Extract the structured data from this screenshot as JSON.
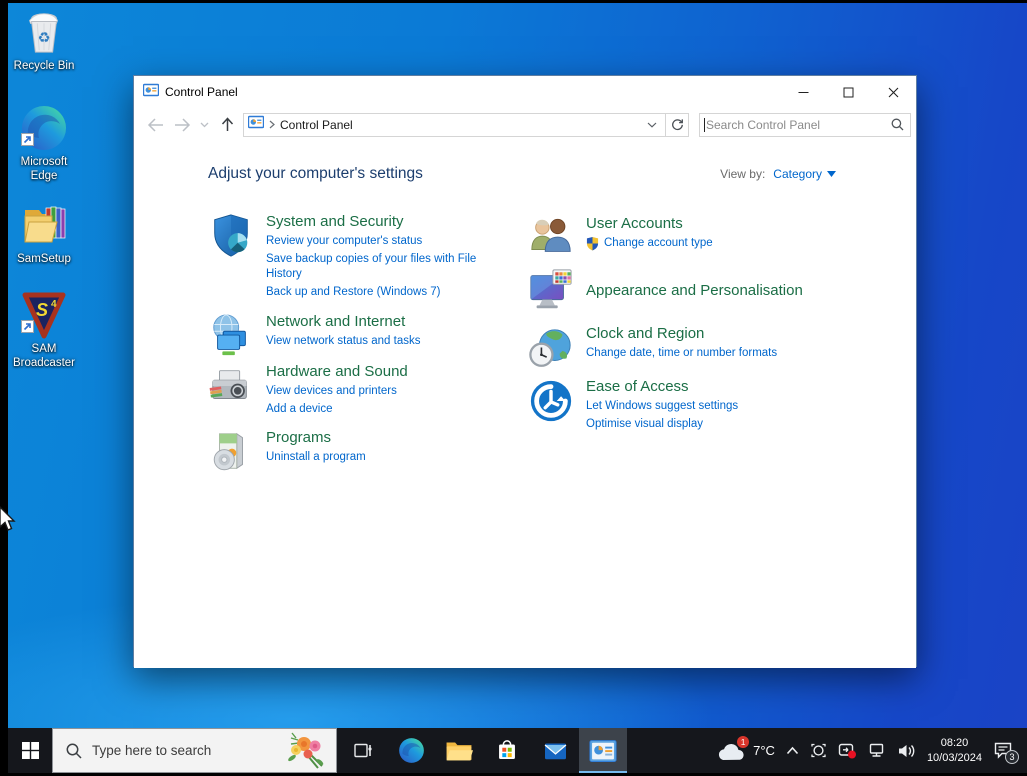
{
  "colors": {
    "desktop_blue": "#0f7bd7",
    "accent": "#0078d7",
    "category_green": "#1b6e46",
    "link_blue": "#0066cc",
    "heading_navy": "#1c3e6e",
    "taskbar_bg": "#15171c",
    "active_underline": "#76b9ed",
    "badge_red": "#d9352b"
  },
  "desktop": {
    "icons": [
      {
        "label": "Recycle Bin",
        "icon": "recycle-bin-icon"
      },
      {
        "label": "Microsoft Edge",
        "icon": "edge-icon"
      },
      {
        "label": "SamSetup",
        "icon": "folder-files-icon"
      },
      {
        "label": "SAM Broadcaster",
        "icon": "sam-broadcaster-icon"
      }
    ]
  },
  "window": {
    "title": "Control Panel",
    "breadcrumb": {
      "location": "Control Panel"
    },
    "search": {
      "placeholder": "Search Control Panel"
    },
    "content": {
      "heading": "Adjust your computer's settings",
      "view_by_label": "View by:",
      "view_by_value": "Category",
      "categories_left": [
        {
          "title": "System and Security",
          "icon": "system-security-shield-icon",
          "links": [
            "Review your computer's status",
            "Save backup copies of your files with File History",
            "Back up and Restore (Windows 7)"
          ]
        },
        {
          "title": "Network and Internet",
          "icon": "network-globe-monitors-icon",
          "links": [
            "View network status and tasks"
          ]
        },
        {
          "title": "Hardware and Sound",
          "icon": "printer-icon",
          "links": [
            "View devices and printers",
            "Add a device"
          ]
        },
        {
          "title": "Programs",
          "icon": "software-box-cd-icon",
          "links": [
            "Uninstall a program"
          ]
        }
      ],
      "categories_right": [
        {
          "title": "User Accounts",
          "icon": "two-users-icon",
          "links": [
            "Change account type"
          ]
        },
        {
          "title": "Appearance and Personalisation",
          "icon": "monitor-palette-icon",
          "links": []
        },
        {
          "title": "Clock and Region",
          "icon": "globe-clock-icon",
          "links": [
            "Change date, time or number formats"
          ]
        },
        {
          "title": "Ease of Access",
          "icon": "ease-of-access-icon",
          "links": [
            "Let Windows suggest settings",
            "Optimise visual display"
          ]
        }
      ]
    }
  },
  "taskbar": {
    "search_placeholder": "Type here to search",
    "buttons": [
      "start",
      "task-view",
      "edge",
      "file-explorer",
      "store",
      "mail",
      "control-panel"
    ],
    "active_button": "control-panel",
    "weather": {
      "temp": "7°C",
      "badge": "1"
    },
    "clock": {
      "time": "08:20",
      "date": "10/03/2024"
    },
    "notifications": {
      "count": "3"
    }
  }
}
